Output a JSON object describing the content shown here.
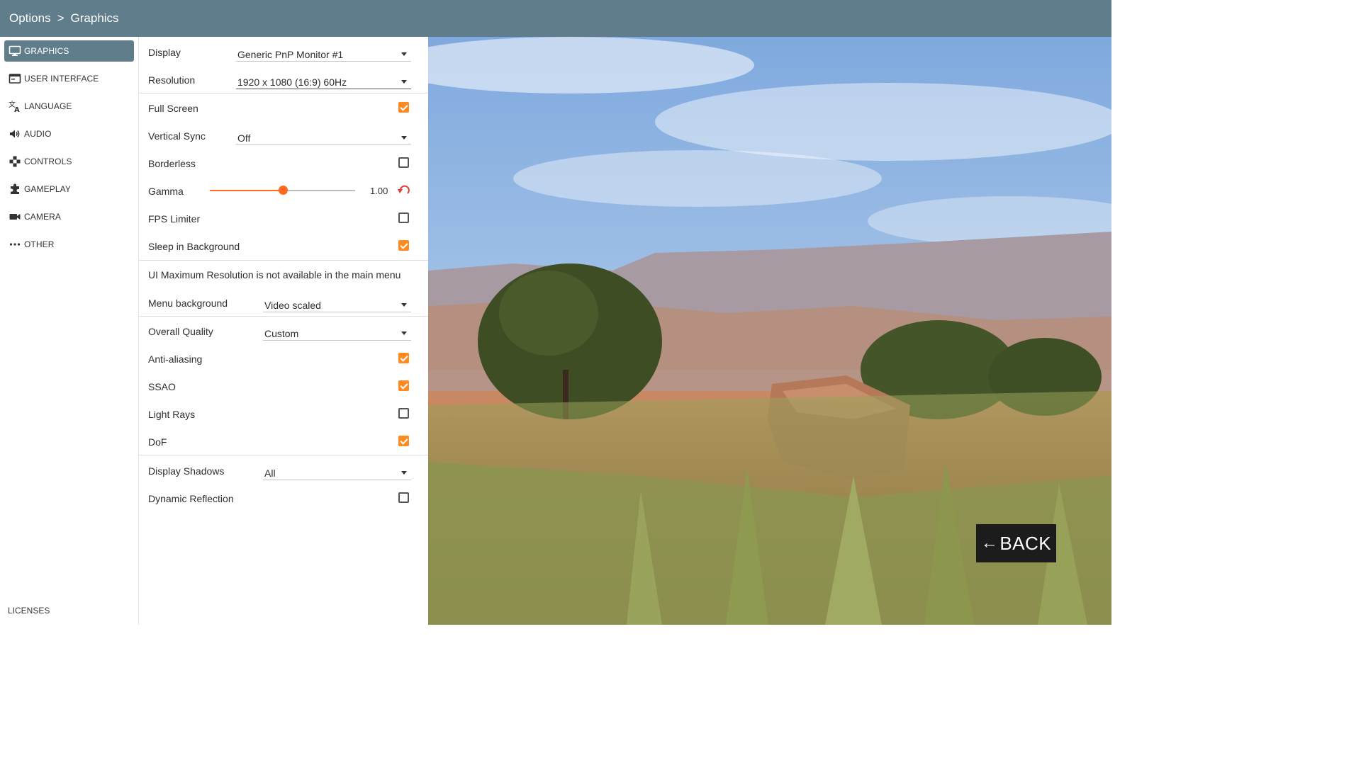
{
  "breadcrumb": {
    "root": "Options",
    "separator": ">",
    "current": "Graphics"
  },
  "sidebar": {
    "items": [
      {
        "label": "GRAPHICS",
        "icon": "monitor-icon",
        "active": true
      },
      {
        "label": "USER INTERFACE",
        "icon": "window-icon"
      },
      {
        "label": "LANGUAGE",
        "icon": "translate-icon"
      },
      {
        "label": "AUDIO",
        "icon": "speaker-icon"
      },
      {
        "label": "CONTROLS",
        "icon": "gamepad-icon"
      },
      {
        "label": "GAMEPLAY",
        "icon": "puzzle-icon"
      },
      {
        "label": "CAMERA",
        "icon": "video-camera-icon"
      },
      {
        "label": "OTHER",
        "icon": "more-dots-icon"
      }
    ],
    "licenses": "LICENSES"
  },
  "settings": {
    "display": {
      "label": "Display",
      "value": "Generic PnP Monitor #1"
    },
    "resolution": {
      "label": "Resolution",
      "value": "1920 x 1080 (16:9) 60Hz"
    },
    "full_screen": {
      "label": "Full Screen",
      "checked": true
    },
    "vertical_sync": {
      "label": "Vertical Sync",
      "value": "Off"
    },
    "borderless": {
      "label": "Borderless",
      "checked": false
    },
    "gamma": {
      "label": "Gamma",
      "value": "1.00",
      "slider_fraction": 0.5
    },
    "fps_limiter": {
      "label": "FPS Limiter",
      "checked": false
    },
    "sleep_in_background": {
      "label": "Sleep in Background",
      "checked": true
    },
    "ui_max_resolution_note": "UI Maximum Resolution is not available in the main menu",
    "menu_background": {
      "label": "Menu background",
      "value": "Video scaled"
    },
    "overall_quality": {
      "label": "Overall Quality",
      "value": "Custom"
    },
    "anti_aliasing": {
      "label": "Anti-aliasing",
      "checked": true
    },
    "ssao": {
      "label": "SSAO",
      "checked": true
    },
    "light_rays": {
      "label": "Light Rays",
      "checked": false
    },
    "dof": {
      "label": "DoF",
      "checked": true
    },
    "display_shadows": {
      "label": "Display Shadows",
      "value": "All"
    },
    "dynamic_reflection": {
      "label": "Dynamic Reflection",
      "checked": false
    }
  },
  "back_button": {
    "label": "BACK",
    "icon": "arrow-left-icon"
  },
  "colors": {
    "header": "#607d8b",
    "accent": "#ff8a1f",
    "slider": "#ff6a1f",
    "back_bg": "#1c1c1c"
  }
}
